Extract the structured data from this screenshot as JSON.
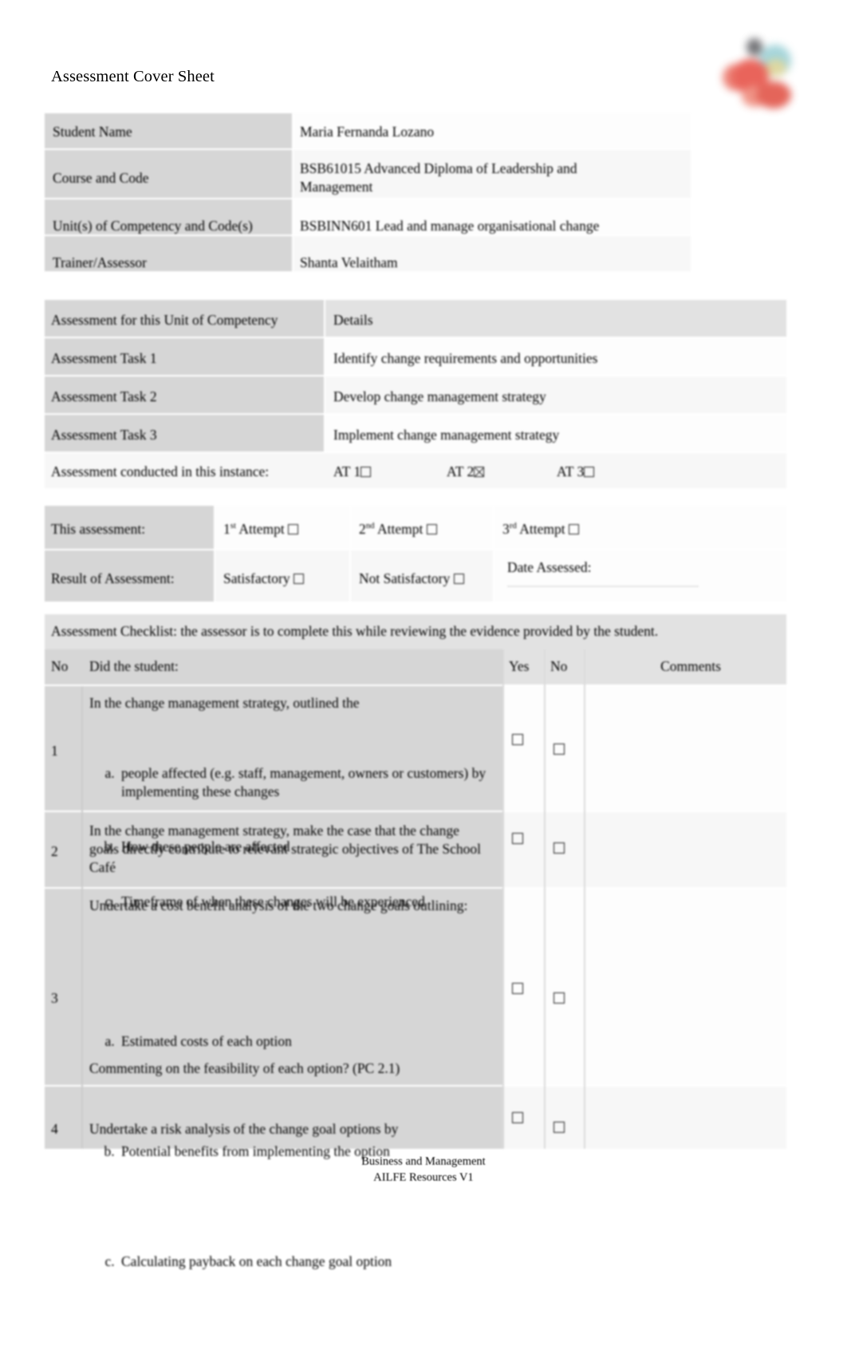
{
  "document": {
    "title": "Assessment Cover Sheet",
    "logo_icon": "organisation-logo-icon"
  },
  "student_details": {
    "rows": [
      {
        "label": "Student Name",
        "value": "Maria Fernanda Lozano"
      },
      {
        "label": "Course and Code",
        "value": "BSB61015 Advanced Diploma of Leadership and Management"
      },
      {
        "label": "Unit(s) of Competency and Code(s)",
        "value": "BSBINN601 Lead and manage organisational change"
      },
      {
        "label": "Trainer/Assessor",
        "value": "Shanta Velaitham"
      }
    ]
  },
  "assessment_tasks": {
    "header": {
      "col1": "Assessment for this Unit of Competency",
      "col2": "Details"
    },
    "rows": [
      {
        "label": "Assessment Task 1",
        "value": "Identify change requirements and opportunities"
      },
      {
        "label": "Assessment Task 2",
        "value": "Develop change management strategy"
      },
      {
        "label": "Assessment Task 3",
        "value": "Implement change management strategy"
      }
    ],
    "instance": {
      "label": "Assessment conducted in this instance:",
      "options": [
        {
          "label": "AT 1",
          "checked": false
        },
        {
          "label": "AT 2",
          "checked": true
        },
        {
          "label": "AT 3",
          "checked": false
        }
      ]
    }
  },
  "attempt_result": {
    "this_assessment_label": "This assessment:",
    "attempts": [
      {
        "num": "1",
        "ord": "st",
        "label": "Attempt",
        "checked": false
      },
      {
        "num": "2",
        "ord": "nd",
        "label": "Attempt",
        "checked": false
      },
      {
        "num": "3",
        "ord": "rd",
        "label": "Attempt",
        "checked": false
      }
    ],
    "result_label": "Result of Assessment:",
    "results": [
      {
        "label": "Satisfactory",
        "checked": false
      },
      {
        "label": "Not Satisfactory",
        "checked": false
      }
    ],
    "date_assessed_label": "Date Assessed:",
    "date_assessed_value": ""
  },
  "checklist": {
    "intro": "Assessment Checklist: the assessor is to complete this while reviewing the evidence provided by the student.",
    "headers": {
      "no": "No",
      "question": "Did the student:",
      "yes": "Yes",
      "no_col": "No",
      "comments": "Comments"
    },
    "rows": [
      {
        "no": "1",
        "lead": "In the change management strategy, outlined the",
        "items": [
          "people affected (e.g. staff, management, owners or customers) by implementing these changes",
          "How these people are affected",
          "Timeframe of when these changes will be experienced"
        ],
        "tail": "",
        "yes_checked": false,
        "no_checked": false,
        "comment": ""
      },
      {
        "no": "2",
        "lead": "In the change management strategy, make the case that the change goals directly contribute to relevant strategic objectives of The School Café",
        "items": [],
        "tail": "",
        "yes_checked": false,
        "no_checked": false,
        "comment": ""
      },
      {
        "no": "3",
        "lead": "Undertake a cost benefit analysis of the two change goals outlining:",
        "items": [
          "Estimated costs of each option",
          "Potential benefits from implementing the option",
          "Calculating payback on each change goal option"
        ],
        "tail": "Commenting on the feasibility of each option? (PC 2.1)",
        "yes_checked": false,
        "no_checked": false,
        "comment": ""
      },
      {
        "no": "4",
        "lead": "Undertake a risk analysis of the change goal options by",
        "items": [],
        "tail": "",
        "yes_checked": false,
        "no_checked": false,
        "comment": ""
      }
    ]
  },
  "footer": {
    "line1": "Business and Management",
    "line2": "AILFE Resources V1"
  }
}
